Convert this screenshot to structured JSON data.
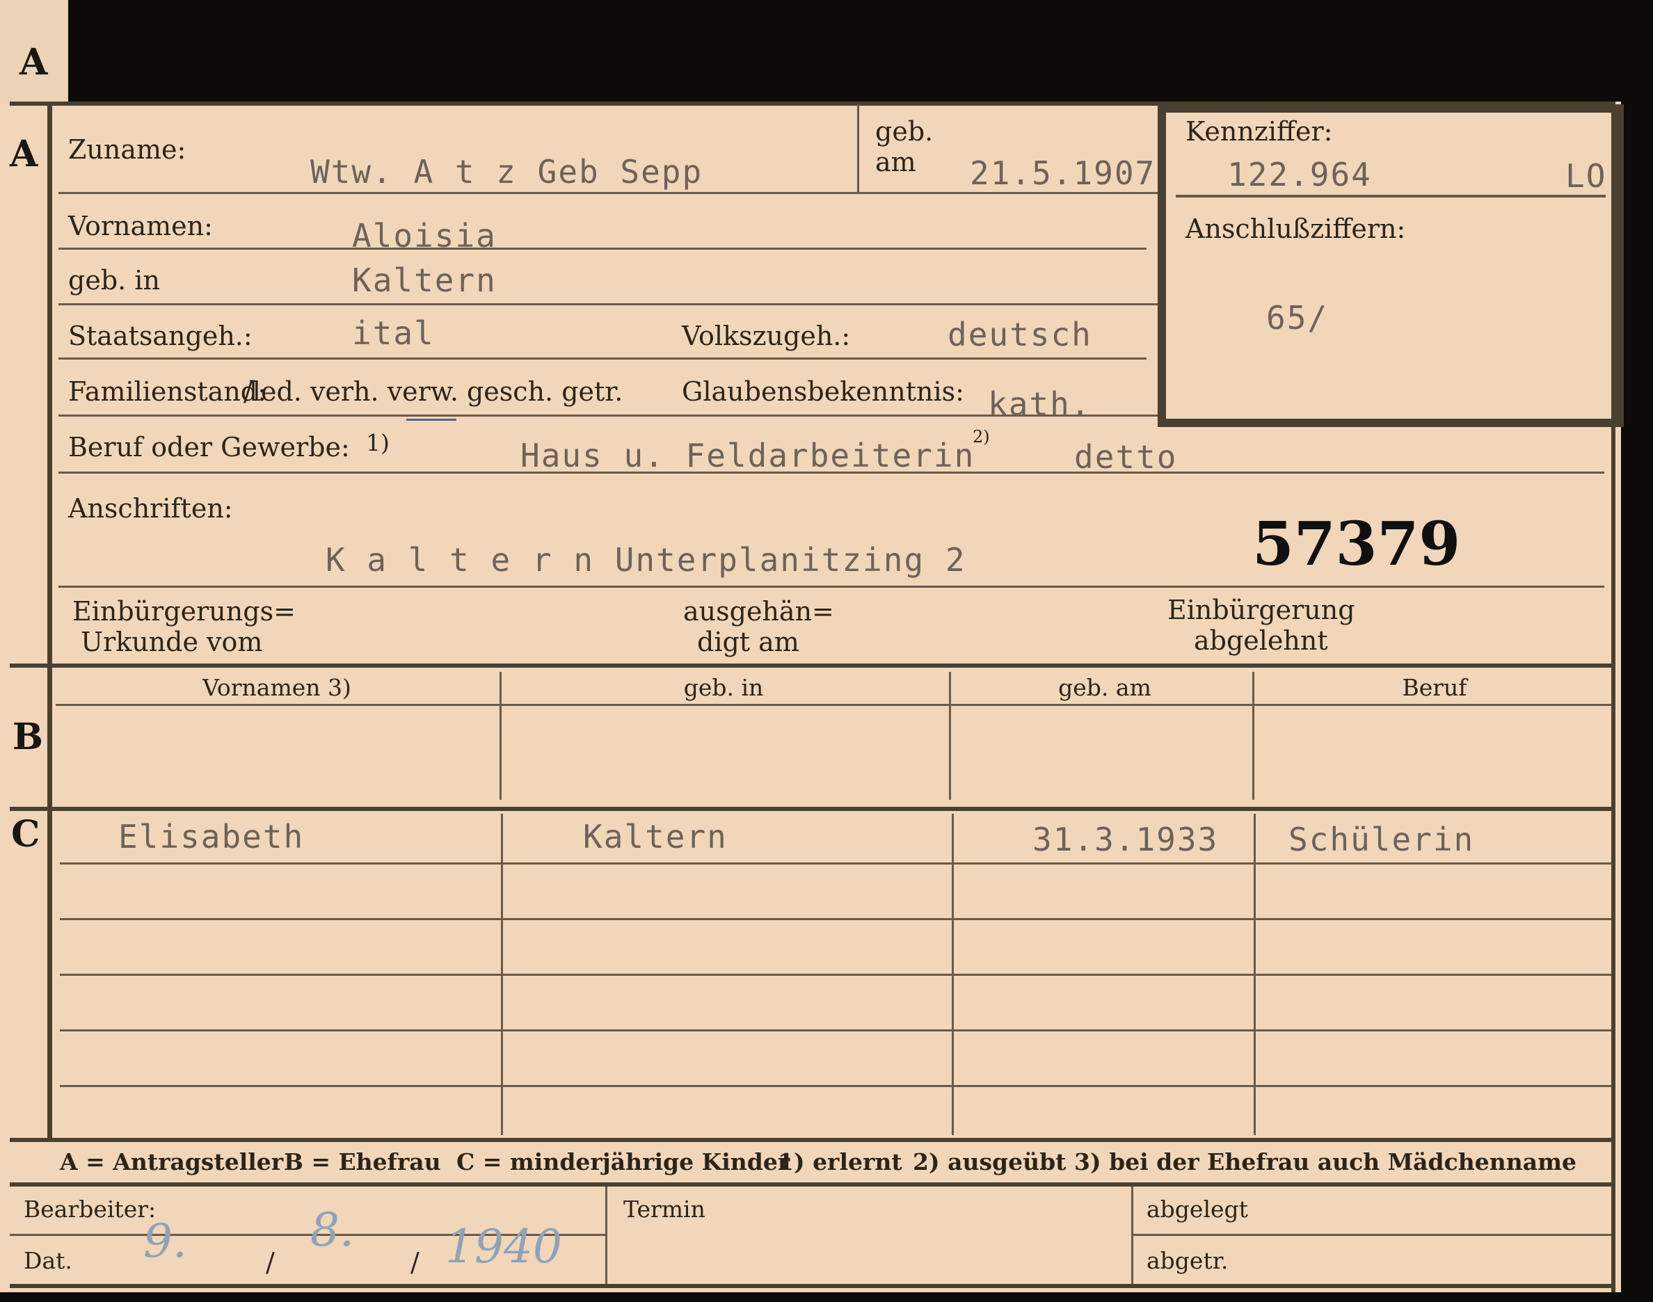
{
  "tab_letter": "A",
  "section_a": {
    "letter": "A",
    "zuname_label": "Zuname:",
    "zuname_value": "Wtw. A t z  Geb Sepp",
    "geb_label_line1": "geb.",
    "geb_label_line2": "am",
    "geb_am_value": "21.5.1907",
    "kennziffer_label": "Kennziffer:",
    "kennziffer_value": "122.964",
    "kennziffer_code": "LO",
    "anschluss_label": "Anschlußziffern:",
    "anschluss_value": "65/",
    "vornamen_label": "Vornamen:",
    "vornamen_value": "Aloisia",
    "geb_in_label": "geb. in",
    "geb_in_value": "Kaltern",
    "staatsangeh_label": "Staatsangeh.:",
    "staatsangeh_value": "ital",
    "volkszugeh_label": "Volkszugeh.:",
    "volkszugeh_value": "deutsch",
    "familienstand_label": "Familienstand:",
    "familienstand_options": "/led. verh. verw. gesch. getr.",
    "glaubens_label": "Glaubensbekenntnis:",
    "glaubens_value": "kath.",
    "beruf_label": "Beruf oder Gewerbe:",
    "beruf_footnote": "1)",
    "beruf_value": "Haus u. Feldarbeiterin",
    "beruf_footnote2": "2)",
    "beruf_value2": "detto",
    "anschriften_label": "Anschriften:",
    "anschriften_value": "K a l t e r n  Unterplanitzing 2",
    "stamp_number": "57379",
    "einb_urkunde_line1": "Einbürgerungs=",
    "einb_urkunde_line2": "Urkunde vom",
    "ausgehaendigt_line1": "ausgehän=",
    "ausgehaendigt_line2": "digt am",
    "einb_abgelehnt_line1": "Einbürgerung",
    "einb_abgelehnt_line2": "abgelehnt"
  },
  "section_b": {
    "letter": "B",
    "columns": [
      "Vornamen 3)",
      "geb. in",
      "geb. am",
      "Beruf"
    ]
  },
  "section_c": {
    "letter": "C",
    "row": {
      "vorname": "Elisabeth",
      "geb_in": "Kaltern",
      "geb_am": "31.3.1933",
      "beruf": "Schülerin"
    }
  },
  "legend": {
    "a": "A = Antragsteller",
    "b": "B = Ehefrau",
    "c": "C = minderjährige Kinder",
    "n1": "1) erlernt",
    "n2": "2) ausgeübt",
    "n3": "3) bei der Ehefrau auch Mädchenname"
  },
  "footer": {
    "bearbeiter_label": "Bearbeiter:",
    "dat_label": "Dat.",
    "date_day": "9.",
    "date_month": "8.",
    "date_year": "1940",
    "date_sep": "/",
    "termin_label": "Termin",
    "abgelegt_label": "abgelegt",
    "abgetr_label": "abgetr."
  }
}
